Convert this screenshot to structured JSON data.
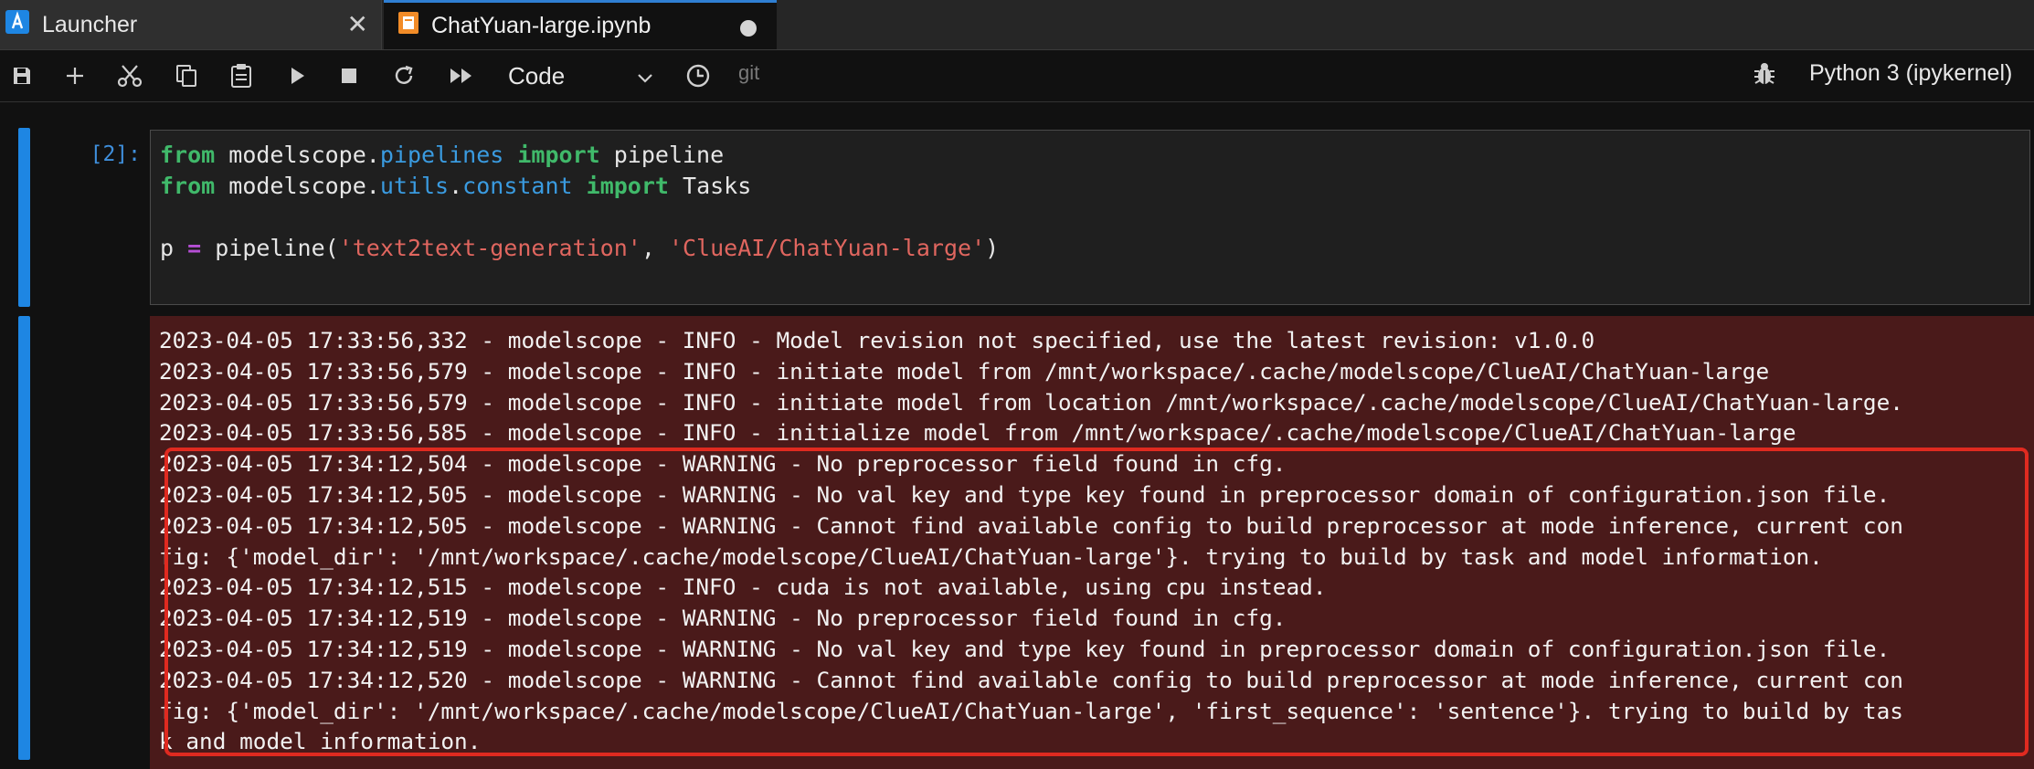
{
  "tabs": [
    {
      "label": "Launcher",
      "icon": "launcher-icon",
      "state": "inactive"
    },
    {
      "label": "ChatYuan-large.ipynb",
      "icon": "notebook-icon",
      "state": "active-unsaved"
    }
  ],
  "toolbar": {
    "buttons": [
      "save-icon",
      "plus-icon",
      "cut-icon",
      "copy-icon",
      "paste-icon",
      "run-icon",
      "stop-icon",
      "restart-icon",
      "fast-forward-icon",
      "clock-icon"
    ],
    "cell_type": "Code",
    "git_label": "git",
    "kernel": "Python 3 (ipykernel)"
  },
  "cell": {
    "prompt": "[2]:",
    "code_lines": [
      [
        {
          "t": "from",
          "c": "kw"
        },
        {
          "t": " modelscope.",
          "c": ""
        },
        {
          "t": "pipelines",
          "c": "mod"
        },
        {
          "t": " ",
          "c": ""
        },
        {
          "t": "import",
          "c": "kw"
        },
        {
          "t": " pipeline",
          "c": ""
        }
      ],
      [
        {
          "t": "from",
          "c": "kw"
        },
        {
          "t": " modelscope.",
          "c": ""
        },
        {
          "t": "utils",
          "c": "mod"
        },
        {
          "t": ".",
          "c": ""
        },
        {
          "t": "constant",
          "c": "mod"
        },
        {
          "t": " ",
          "c": ""
        },
        {
          "t": "import",
          "c": "kw"
        },
        {
          "t": " Tasks",
          "c": ""
        }
      ],
      [
        {
          "t": "",
          "c": ""
        }
      ],
      [
        {
          "t": "p ",
          "c": ""
        },
        {
          "t": "=",
          "c": "op"
        },
        {
          "t": " pipeline(",
          "c": ""
        },
        {
          "t": "'text2text-generation'",
          "c": "str"
        },
        {
          "t": ", ",
          "c": ""
        },
        {
          "t": "'ClueAI/ChatYuan-large'",
          "c": "str"
        },
        {
          "t": ")",
          "c": ""
        }
      ]
    ],
    "output_lines": [
      "2023-04-05 17:33:56,332 - modelscope - INFO - Model revision not specified, use the latest revision: v1.0.0",
      "2023-04-05 17:33:56,579 - modelscope - INFO - initiate model from /mnt/workspace/.cache/modelscope/ClueAI/ChatYuan-large",
      "2023-04-05 17:33:56,579 - modelscope - INFO - initiate model from location /mnt/workspace/.cache/modelscope/ClueAI/ChatYuan-large.",
      "2023-04-05 17:33:56,585 - modelscope - INFO - initialize model from /mnt/workspace/.cache/modelscope/ClueAI/ChatYuan-large",
      "2023-04-05 17:34:12,504 - modelscope - WARNING - No preprocessor field found in cfg.",
      "2023-04-05 17:34:12,505 - modelscope - WARNING - No val key and type key found in preprocessor domain of configuration.json file.",
      "2023-04-05 17:34:12,505 - modelscope - WARNING - Cannot find available config to build preprocessor at mode inference, current con",
      "fig: {'model_dir': '/mnt/workspace/.cache/modelscope/ClueAI/ChatYuan-large'}. trying to build by task and model information.",
      "2023-04-05 17:34:12,515 - modelscope - INFO - cuda is not available, using cpu instead.",
      "2023-04-05 17:34:12,519 - modelscope - WARNING - No preprocessor field found in cfg.",
      "2023-04-05 17:34:12,519 - modelscope - WARNING - No val key and type key found in preprocessor domain of configuration.json file.",
      "2023-04-05 17:34:12,520 - modelscope - WARNING - Cannot find available config to build preprocessor at mode inference, current con",
      "fig: {'model_dir': '/mnt/workspace/.cache/modelscope/ClueAI/ChatYuan-large', 'first_sequence': 'sentence'}. trying to build by tas",
      "k and model information."
    ]
  },
  "colors": {
    "accent": "#1e86e3",
    "output_bg": "#4a1a1a",
    "highlight": "#e02a20"
  }
}
